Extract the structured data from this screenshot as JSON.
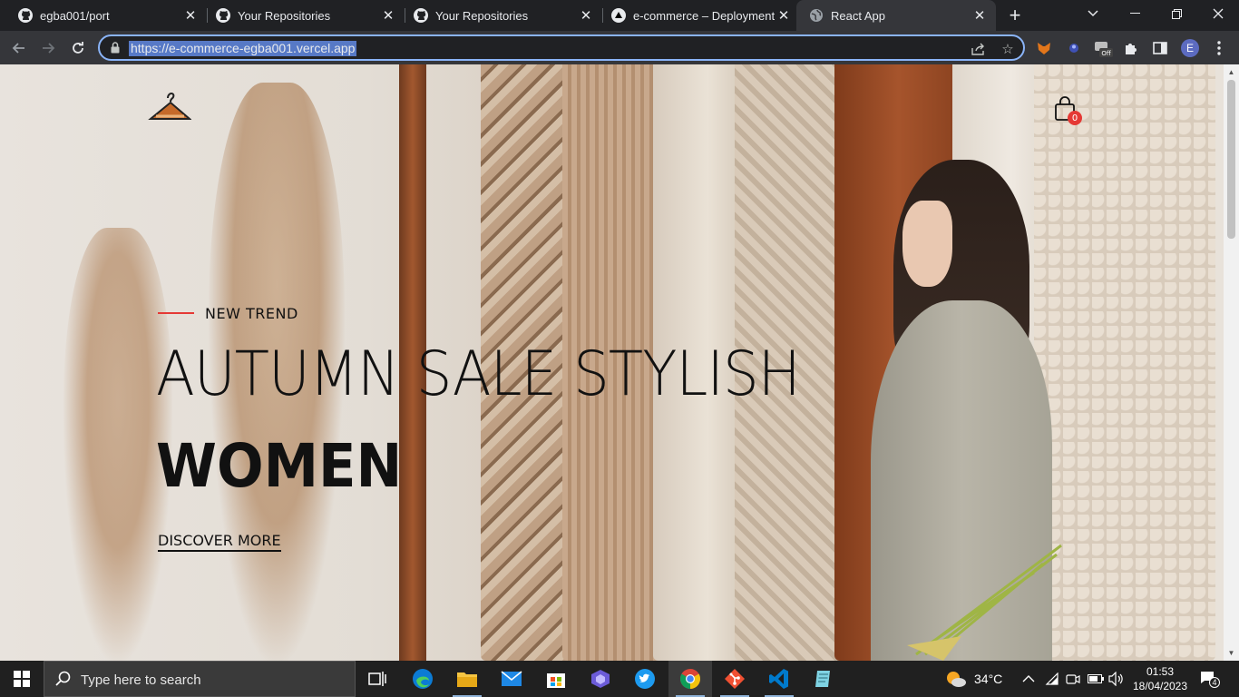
{
  "browser": {
    "tabs": [
      {
        "title": "egba001/port",
        "favicon": "github-icon"
      },
      {
        "title": "Your Repositories",
        "favicon": "github-icon"
      },
      {
        "title": "Your Repositories",
        "favicon": "github-icon"
      },
      {
        "title": "e-commerce – Deployment O",
        "favicon": "vercel-icon"
      },
      {
        "title": "React App",
        "favicon": "globe-icon",
        "active": true
      }
    ],
    "url": "https://e-commerce-egba001.vercel.app",
    "profile_initial": "E",
    "extension_badge": "Off"
  },
  "page": {
    "eyebrow": "NEW TREND",
    "headline": "AUTUMN SALE STYLISH",
    "headline_strong": "WOMEN",
    "cta": "DISCOVER MORE",
    "cart_count": "0",
    "accent_color": "#e53935"
  },
  "taskbar": {
    "search_placeholder": "Type here to search",
    "weather": "34°C",
    "time": "01:53",
    "date": "18/04/2023",
    "notifications": "4",
    "apps": [
      "task-view-icon",
      "edge-icon",
      "file-explorer-icon",
      "mail-icon",
      "store-icon",
      "copilot-icon",
      "twitter-icon",
      "chrome-icon",
      "git-icon",
      "vscode-icon",
      "notepad-icon"
    ]
  }
}
